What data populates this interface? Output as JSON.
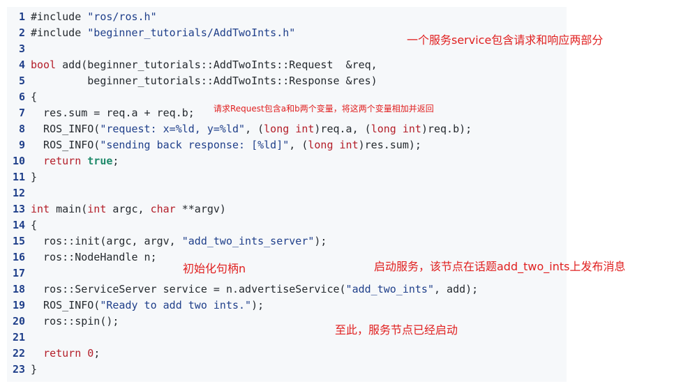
{
  "code": {
    "lines": [
      {
        "n": "1",
        "tokens": [
          {
            "t": "#include ",
            "c": "pp"
          },
          {
            "t": "\"ros/ros.h\"",
            "c": "st"
          }
        ]
      },
      {
        "n": "2",
        "tokens": [
          {
            "t": "#include ",
            "c": "pp"
          },
          {
            "t": "\"beginner_tutorials/AddTwoInts.h\"",
            "c": "st"
          }
        ]
      },
      {
        "n": "3",
        "tokens": []
      },
      {
        "n": "4",
        "tokens": [
          {
            "t": "bool",
            "c": "ty"
          },
          {
            "t": " add(beginner_tutorials::AddTwoInts::Request  &req,",
            "c": ""
          }
        ]
      },
      {
        "n": "5",
        "tokens": [
          {
            "t": "         beginner_tutorials::AddTwoInts::Response &res)",
            "c": ""
          }
        ]
      },
      {
        "n": "6",
        "tokens": [
          {
            "t": "{",
            "c": ""
          }
        ]
      },
      {
        "n": "7",
        "tokens": [
          {
            "t": "  res.sum = req.a + req.b;",
            "c": ""
          }
        ]
      },
      {
        "n": "8",
        "tokens": [
          {
            "t": "  ROS_INFO(",
            "c": ""
          },
          {
            "t": "\"request: x=%ld, y=%ld\"",
            "c": "st"
          },
          {
            "t": ", (",
            "c": ""
          },
          {
            "t": "long",
            "c": "ty"
          },
          {
            "t": " ",
            "c": ""
          },
          {
            "t": "int",
            "c": "ty"
          },
          {
            "t": ")req.a, (",
            "c": ""
          },
          {
            "t": "long",
            "c": "ty"
          },
          {
            "t": " ",
            "c": ""
          },
          {
            "t": "int",
            "c": "ty"
          },
          {
            "t": ")req.b);",
            "c": ""
          }
        ]
      },
      {
        "n": "9",
        "tokens": [
          {
            "t": "  ROS_INFO(",
            "c": ""
          },
          {
            "t": "\"sending back response: [%ld]\"",
            "c": "st"
          },
          {
            "t": ", (",
            "c": ""
          },
          {
            "t": "long",
            "c": "ty"
          },
          {
            "t": " ",
            "c": ""
          },
          {
            "t": "int",
            "c": "ty"
          },
          {
            "t": ")res.sum);",
            "c": ""
          }
        ]
      },
      {
        "n": "10",
        "tokens": [
          {
            "t": "  ",
            "c": ""
          },
          {
            "t": "return",
            "c": "kw"
          },
          {
            "t": " ",
            "c": ""
          },
          {
            "t": "true",
            "c": "lit"
          },
          {
            "t": ";",
            "c": ""
          }
        ]
      },
      {
        "n": "11",
        "tokens": [
          {
            "t": "}",
            "c": ""
          }
        ]
      },
      {
        "n": "12",
        "tokens": []
      },
      {
        "n": "13",
        "tokens": [
          {
            "t": "int",
            "c": "ty"
          },
          {
            "t": " main(",
            "c": ""
          },
          {
            "t": "int",
            "c": "ty"
          },
          {
            "t": " argc, ",
            "c": ""
          },
          {
            "t": "char",
            "c": "ty"
          },
          {
            "t": " **argv)",
            "c": ""
          }
        ]
      },
      {
        "n": "14",
        "tokens": [
          {
            "t": "{",
            "c": ""
          }
        ]
      },
      {
        "n": "15",
        "tokens": [
          {
            "t": "  ros::init(argc, argv, ",
            "c": ""
          },
          {
            "t": "\"add_two_ints_server\"",
            "c": "st"
          },
          {
            "t": ");",
            "c": ""
          }
        ]
      },
      {
        "n": "16",
        "tokens": [
          {
            "t": "  ros::NodeHandle n;",
            "c": ""
          }
        ]
      },
      {
        "n": "17",
        "tokens": []
      },
      {
        "n": "18",
        "tokens": [
          {
            "t": "  ros::ServiceServer service = n.advertiseService(",
            "c": ""
          },
          {
            "t": "\"add_two_ints\"",
            "c": "st"
          },
          {
            "t": ", add);",
            "c": ""
          }
        ]
      },
      {
        "n": "19",
        "tokens": [
          {
            "t": "  ROS_INFO(",
            "c": ""
          },
          {
            "t": "\"Ready to add two ints.\"",
            "c": "st"
          },
          {
            "t": ");",
            "c": ""
          }
        ]
      },
      {
        "n": "20",
        "tokens": [
          {
            "t": "  ros::spin();",
            "c": ""
          }
        ]
      },
      {
        "n": "21",
        "tokens": []
      },
      {
        "n": "22",
        "tokens": [
          {
            "t": "  ",
            "c": ""
          },
          {
            "t": "return",
            "c": "kw"
          },
          {
            "t": " ",
            "c": ""
          },
          {
            "t": "0",
            "c": "nu"
          },
          {
            "t": ";",
            "c": ""
          }
        ]
      },
      {
        "n": "23",
        "tokens": [
          {
            "t": "}",
            "c": ""
          }
        ]
      }
    ]
  },
  "annotations": {
    "service_parts": "一个服务service包含请求和响应两部分",
    "request_vars": "请求Request包含a和b两个变量，将这两个变量相加并返回",
    "init_handle": "初始化句柄n",
    "start_service": "启动服务，该节点在话题add_two_ints上发布消息",
    "node_started": "至此，服务节点已经启动"
  },
  "colors": {
    "code_background": "#f6f8fa",
    "line_number": "#1f3f8a",
    "keyword": "#b31d28",
    "string": "#1f3f8a",
    "literal_true": "#1f8a6a",
    "annotation": "#e02020"
  }
}
